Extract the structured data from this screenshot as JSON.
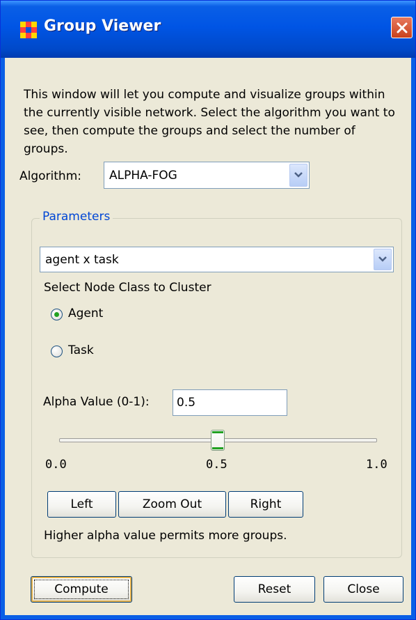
{
  "window": {
    "title": "Group Viewer",
    "colors": {
      "titlebar": "#0055e5",
      "close_button": "#c8411c",
      "client_background": "#ece9d8",
      "accent_green": "#21a121",
      "group_title": "#0046d5"
    },
    "icons": {
      "app": "app-grid-icon",
      "close": "close-icon"
    }
  },
  "description": "This window will let you compute and visualize groups within the currently visible network. Select the algorithm you want to see, then compute the groups and select the number of groups.",
  "algorithm": {
    "label": "Algorithm:",
    "selected": "ALPHA-FOG"
  },
  "parameters": {
    "title": "Parameters",
    "network_selected": "agent x task",
    "node_class_label": "Select Node Class to Cluster",
    "radios": [
      {
        "label": "Agent",
        "selected": true
      },
      {
        "label": "Task",
        "selected": false
      }
    ],
    "alpha": {
      "label": "Alpha Value (0-1):",
      "value": "0.5"
    },
    "slider": {
      "value": 0.5,
      "min_label": "0.0",
      "mid_label": "0.5",
      "max_label": "1.0"
    },
    "buttons": {
      "left": "Left",
      "zoom_out": "Zoom Out",
      "right": "Right"
    },
    "hint": "Higher alpha value permits more groups."
  },
  "footer": {
    "compute": "Compute",
    "reset": "Reset",
    "close": "Close"
  }
}
